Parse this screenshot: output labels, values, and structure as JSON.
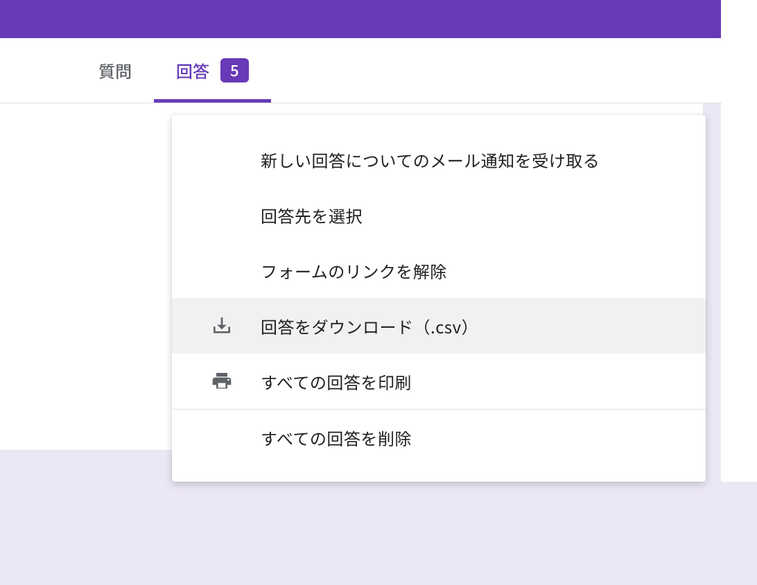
{
  "tabs": {
    "questions": {
      "label": "質問"
    },
    "responses": {
      "label": "回答",
      "count": "5"
    }
  },
  "menu": {
    "email_notify": "新しい回答についてのメール通知を受け取る",
    "select_destination": "回答先を選択",
    "unlink_form": "フォームのリンクを解除",
    "download_csv": "回答をダウンロード（.csv）",
    "print_all": "すべての回答を印刷",
    "delete_all": "すべての回答を削除"
  },
  "colors": {
    "primary": "#673ab7",
    "bg_light": "#ece7f5",
    "text_muted": "#5f6368",
    "icon_gray": "#5f6368"
  }
}
